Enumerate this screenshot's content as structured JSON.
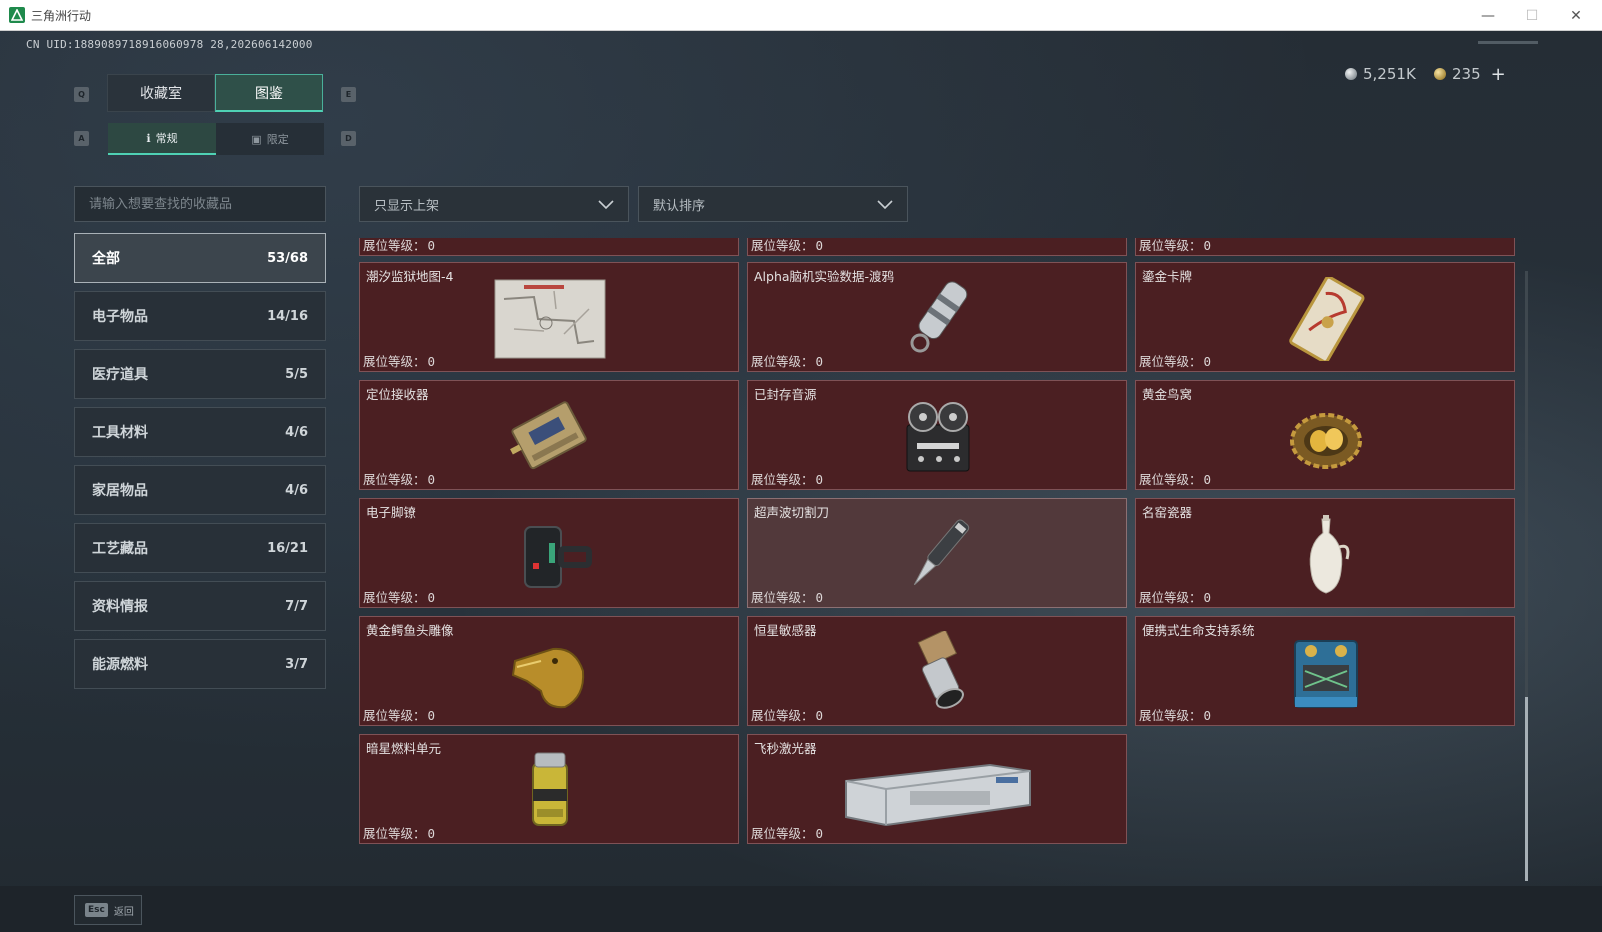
{
  "window": {
    "title": "三角洲行动",
    "min": "—",
    "max": "☐",
    "close": "✕"
  },
  "uid": "CN UID:1889089718916060978 28,202606142000",
  "currency": [
    {
      "icon": "silver-coin-icon",
      "value": "5,251K"
    },
    {
      "icon": "gold-coin-icon",
      "value": "235",
      "plus": "+"
    }
  ],
  "tabs": {
    "prev_key": "Q",
    "next_key": "E",
    "items": [
      {
        "label": "收藏室",
        "active": false
      },
      {
        "label": "图鉴",
        "active": true
      }
    ]
  },
  "subtabs": {
    "prev_key": "A",
    "next_key": "D",
    "items": [
      {
        "label": "常规",
        "icon": "ℹ",
        "active": true
      },
      {
        "label": "限定",
        "icon": "▣",
        "active": false
      }
    ]
  },
  "search": {
    "placeholder": "请输入想要查找的收藏品"
  },
  "filters": [
    {
      "label": "只显示上架"
    },
    {
      "label": "默认排序"
    }
  ],
  "categories": [
    {
      "label": "全部",
      "count": "53/68",
      "active": true
    },
    {
      "label": "电子物品",
      "count": "14/16"
    },
    {
      "label": "医疗道具",
      "count": "5/5"
    },
    {
      "label": "工具材料",
      "count": "4/6"
    },
    {
      "label": "家居物品",
      "count": "4/6"
    },
    {
      "label": "工艺藏品",
      "count": "16/21"
    },
    {
      "label": "资料情报",
      "count": "7/7"
    },
    {
      "label": "能源燃料",
      "count": "3/7"
    }
  ],
  "level_label": "展位等级：",
  "partial_row": [
    {
      "level": "0"
    },
    {
      "level": "0"
    },
    {
      "level": "0"
    }
  ],
  "items": [
    {
      "name": "潮汐监狱地图-4",
      "level": "0",
      "icon": "map-icon"
    },
    {
      "name": "Alpha脑机实验数据-渡鸦",
      "level": "0",
      "icon": "data-drive-icon"
    },
    {
      "name": "鎏金卡牌",
      "level": "0",
      "icon": "gold-card-icon"
    },
    {
      "name": "定位接收器",
      "level": "0",
      "icon": "receiver-icon"
    },
    {
      "name": "已封存音源",
      "level": "0",
      "icon": "tape-recorder-icon"
    },
    {
      "name": "黄金鸟窝",
      "level": "0",
      "icon": "golden-nest-icon"
    },
    {
      "name": "电子脚镣",
      "level": "0",
      "icon": "ankle-monitor-icon"
    },
    {
      "name": "超声波切割刀",
      "level": "0",
      "icon": "ultrasonic-cutter-icon",
      "highlighted": true
    },
    {
      "name": "名窑瓷器",
      "level": "0",
      "icon": "porcelain-vase-icon"
    },
    {
      "name": "黄金鳄鱼头雕像",
      "level": "0",
      "icon": "gold-crocodile-icon"
    },
    {
      "name": "恒星敏感器",
      "level": "0",
      "icon": "star-sensor-icon"
    },
    {
      "name": "便携式生命支持系统",
      "level": "0",
      "icon": "life-support-icon"
    },
    {
      "name": "暗星燃料单元",
      "level": "0",
      "icon": "fuel-cell-icon"
    },
    {
      "name": "飞秒激光器",
      "level": "0",
      "icon": "femtosecond-laser-icon"
    }
  ],
  "bottom": {
    "key": "Esc",
    "label": "返回"
  },
  "colors": {
    "accent": "#4fd1b4",
    "card_bg": "#4b1f22",
    "card_border": "#7f5256"
  }
}
